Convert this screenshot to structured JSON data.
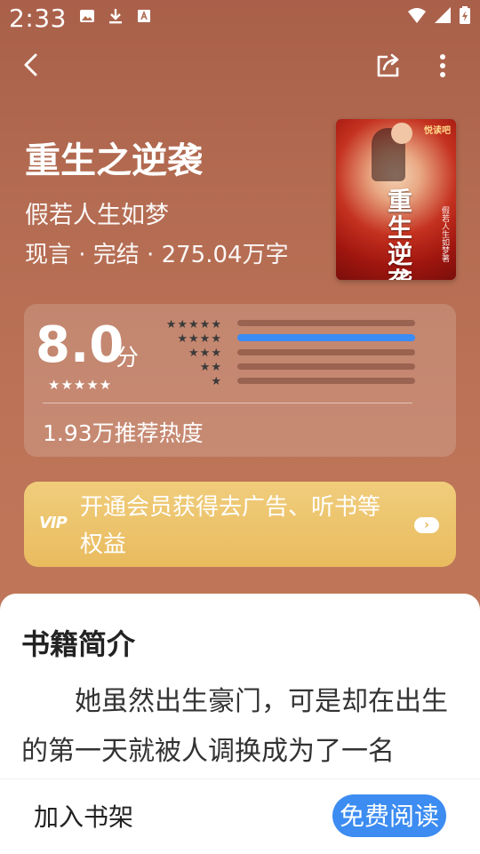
{
  "status_bar": {
    "time": "2:33",
    "left_icons": [
      "image-icon",
      "download-icon",
      "font-icon"
    ],
    "right_icons": [
      "wifi-icon",
      "signal-icon",
      "battery-charging-icon"
    ]
  },
  "nav": {
    "back_icon": "chevron-left-icon",
    "share_icon": "share-icon",
    "more_icon": "more-vertical-icon"
  },
  "book": {
    "title": "重生之逆袭",
    "author": "假若人生如梦",
    "meta": "现言 · 完结 · 275.04万字",
    "cover": {
      "title_vertical": "重生逆袭",
      "author_vertical": "假若人生如梦著",
      "brand": "悦读吧"
    }
  },
  "rating": {
    "score": "8.0",
    "unit": "分",
    "stars_display": "★★★★★",
    "distribution": [
      {
        "stars": "★★★★★",
        "fraction": 0.0
      },
      {
        "stars": "★★★★",
        "fraction": 1.0
      },
      {
        "stars": "★★★",
        "fraction": 0.0
      },
      {
        "stars": "★★",
        "fraction": 0.0
      },
      {
        "stars": "★",
        "fraction": 0.0
      }
    ],
    "popularity": "1.93万推荐热度"
  },
  "vip_banner": {
    "badge": "VIP",
    "text": "开通会员获得去广告、听书等权益",
    "arrow_icon": "chevron-right-icon",
    "accent_color": "#e9bb5e"
  },
  "intro": {
    "heading": "书籍简介",
    "text": "她虽然出生豪门，可是却在出生的第一天就被人调换成为了一名"
  },
  "bottom_bar": {
    "add_shelf": "加入书架",
    "read_free": "免费阅读",
    "accent_color": "#3c8cf1"
  }
}
